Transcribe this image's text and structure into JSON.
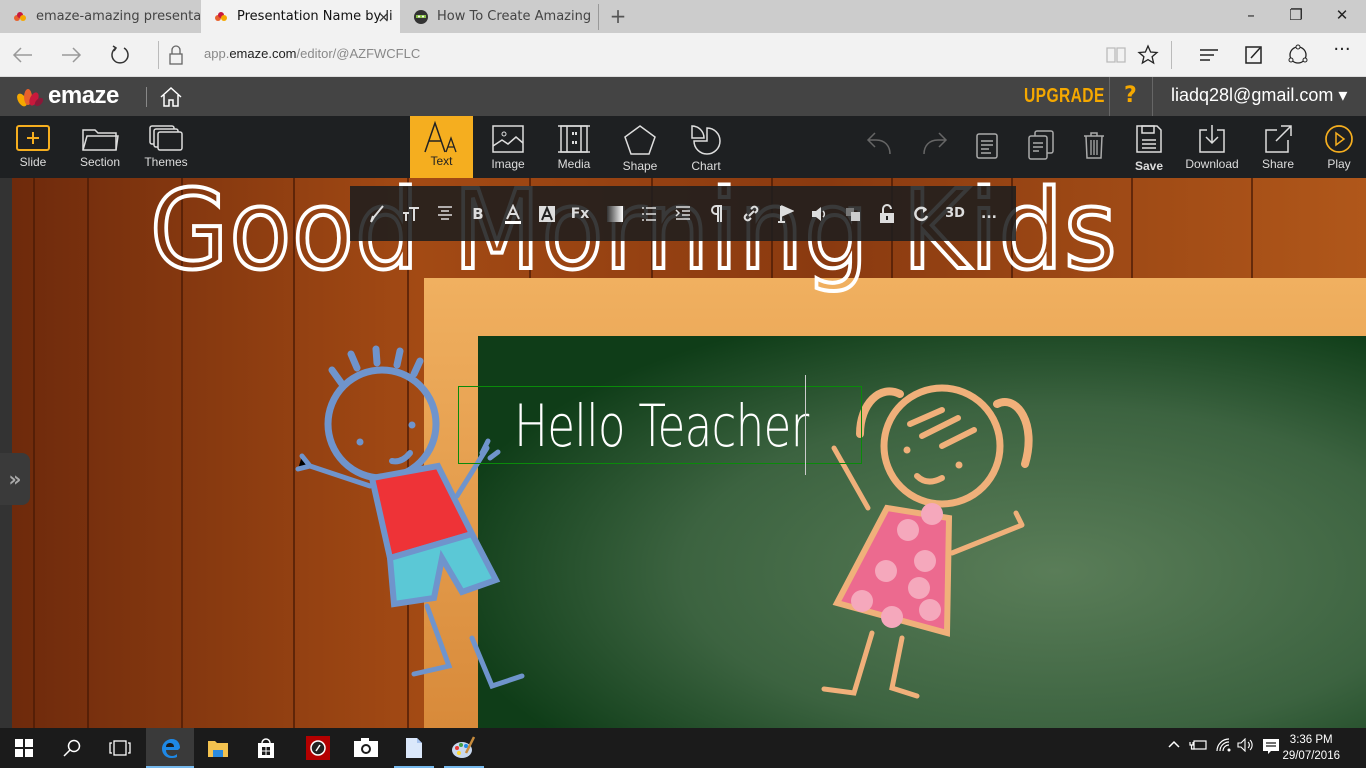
{
  "browser": {
    "tabs": [
      {
        "title": "emaze-amazing presentatior",
        "active": false
      },
      {
        "title": "Presentation Name by li",
        "active": true,
        "close": "×"
      },
      {
        "title": "How To Create Amazing Pres",
        "active": false
      }
    ],
    "new_tab": "+",
    "window_controls": {
      "minimize": "–",
      "restore": "❐",
      "close": "✕"
    },
    "url_prefix": "app.",
    "url_domain": "emaze.com",
    "url_path": "/editor/@AZFWCFLC"
  },
  "app_header": {
    "logo": "emaze",
    "upgrade": "UPGRADE",
    "help": "?",
    "user_email": "liadq28l@gmail.com",
    "user_caret": "▾"
  },
  "toolbar": {
    "slide": "Slide",
    "section": "Section",
    "themes": "Themes",
    "text": "Text",
    "image": "Image",
    "media": "Media",
    "shape": "Shape",
    "chart": "Chart",
    "save": "Save",
    "download": "Download",
    "share": "Share",
    "play": "Play"
  },
  "format_bar": {
    "bold": "B",
    "three_d": "3D",
    "more": "..."
  },
  "slide": {
    "title": "Good Morning Kids",
    "textbox": "Hello Teacher",
    "expand_panel": "»"
  },
  "taskbar": {
    "time": "3:36 PM",
    "date": "29/07/2016"
  },
  "colors": {
    "accent": "#f5ae1f",
    "upgrade": "#f5a800",
    "header": "#444444",
    "toolbar": "#1e2022",
    "chalkboard": "#2f5a35",
    "textbox_border": "#0a8a0a"
  }
}
